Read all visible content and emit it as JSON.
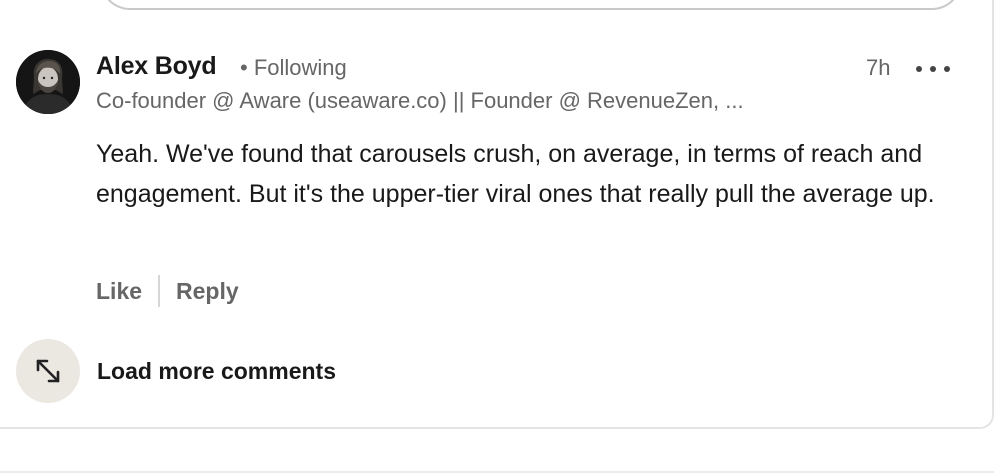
{
  "comment": {
    "author_name": "Alex Boyd",
    "connection_status": "• Following",
    "timestamp": "7h",
    "headline": "Co-founder @ Aware (useaware.co) || Founder @ RevenueZen, ...",
    "text": "Yeah. We've found that carousels crush, on average, in terms of reach and engagement. But it's the upper-tier viral ones that really pull the average up.",
    "actions": {
      "like_label": "Like",
      "reply_label": "Reply"
    },
    "avatar_icon": "profile-photo",
    "more_icon": "ellipsis-icon"
  },
  "load_more": {
    "label": "Load more comments",
    "icon": "expand-arrows-icon"
  },
  "colors": {
    "primary_text": "#191919",
    "secondary_text": "#666666",
    "icon_bg": "#ebe8e2"
  }
}
